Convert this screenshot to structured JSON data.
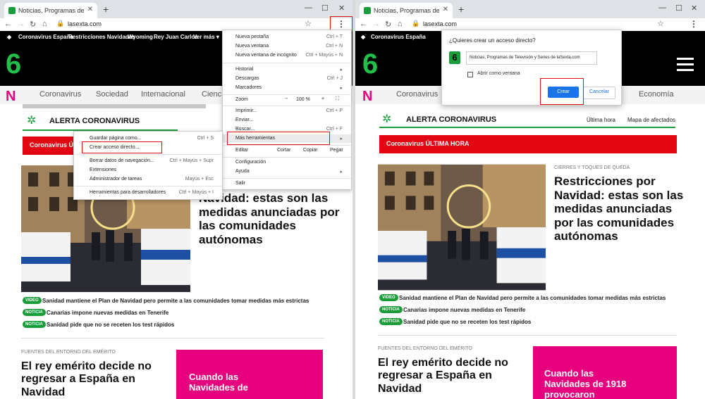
{
  "browser": {
    "tab_title": "Noticias, Programas de Televisión y Series de laSexta.com",
    "tab_title_short": "Noticias, Programas de Televisió",
    "url": "lasexta.com"
  },
  "site": {
    "topbar_left": [
      "Coronavirus España",
      "Restricciones Navidades",
      "Wyoming",
      "Rey Juan Carlos",
      "Ver más ▾"
    ],
    "topbar_right": [
      "Coronavirus España"
    ],
    "nav_left": [
      "Coronavirus",
      "Sociedad",
      "Internacional",
      "Cienc"
    ],
    "nav_right": [
      "Coronavirus",
      "Economía"
    ],
    "alert": "ALERTA CORONAVIRUS",
    "alert_links": [
      "Última hora",
      "Mapa de afectados"
    ],
    "red_bar": "Coronavirus ÚLTIMA HORA",
    "red_bar_left": "Coronavirus Ú",
    "kicker1": "CIERRES Y TOQUES DE QUEDA",
    "headline1": "Restricciones por Navidad: estas son las medidas anunciadas por las comunidades autónomas",
    "headline1_left": "Navidad: estas son las medidas anunciadas por las comunidades autónomas",
    "items": [
      {
        "tag": "VIDEO",
        "text": "Sanidad mantiene el Plan de Navidad pero permite a las comunidades tomar medidas más estrictas"
      },
      {
        "tag": "NOTICIA",
        "text": "Canarias impone nuevas medidas en Tenerife"
      },
      {
        "tag": "NOTICIA",
        "text": "Sanidad pide que no se receten los test rápidos"
      }
    ],
    "kicker2": "FUENTES DEL ENTORNO DEL EMÉRITO",
    "headline2": "El rey emérito decide no regresar a España en Navidad",
    "card_left": "Cuando las Navidades de",
    "card_right": "Cuando las Navidades de 1918 provocaron"
  },
  "chrome_menu": [
    {
      "label": "Nueva pestaña",
      "shortcut": "Ctrl + T"
    },
    {
      "label": "Nueva ventana",
      "shortcut": "Ctrl + N"
    },
    {
      "label": "Nueva ventana de incógnito",
      "shortcut": "Ctrl + Mayús + N"
    },
    {
      "label": "Historial",
      "shortcut": "▸"
    },
    {
      "label": "Descargas",
      "shortcut": "Ctrl + J"
    },
    {
      "label": "Marcadores",
      "shortcut": "▸"
    },
    {
      "label": "Zoom",
      "shortcut": ""
    },
    {
      "label": "Imprimir...",
      "shortcut": "Ctrl + P"
    },
    {
      "label": "Enviar...",
      "shortcut": ""
    },
    {
      "label": "Buscar...",
      "shortcut": "Ctrl + F"
    },
    {
      "label": "Más herramientas",
      "shortcut": "▸"
    },
    {
      "label": "Editar",
      "shortcut": ""
    },
    {
      "label": "Configuración",
      "shortcut": ""
    },
    {
      "label": "Ayuda",
      "shortcut": "▸"
    },
    {
      "label": "Salir",
      "shortcut": ""
    }
  ],
  "zoom": {
    "minus": "−",
    "value": "100 %",
    "plus": "+",
    "full": "⛶"
  },
  "edit": {
    "cut": "Cortar",
    "copy": "Copiar",
    "paste": "Pegar"
  },
  "submenu": [
    {
      "label": "Guardar página como...",
      "shortcut": "Ctrl + S"
    },
    {
      "label": "Crear acceso directo...",
      "shortcut": ""
    },
    {
      "label": "Borrar datos de navegación...",
      "shortcut": "Ctrl + Mayús + Supr"
    },
    {
      "label": "Extensiones",
      "shortcut": ""
    },
    {
      "label": "Administrador de tareas",
      "shortcut": "Mayús + Esc"
    },
    {
      "label": "Herramientas para desarrolladores",
      "shortcut": "Ctrl + Mayús + I"
    }
  ],
  "dialog": {
    "title": "¿Quieres crear un acceso directo?",
    "name_value": "Noticias, Programas de Televisión y Series de laSexta.com",
    "checkbox_label": "Abrir como ventana",
    "create": "Crear",
    "cancel": "Cancelar"
  },
  "colors": {
    "green": "#1a9c3a",
    "red": "#e30613",
    "pink": "#e6007e",
    "blue": "#1a73e8"
  }
}
